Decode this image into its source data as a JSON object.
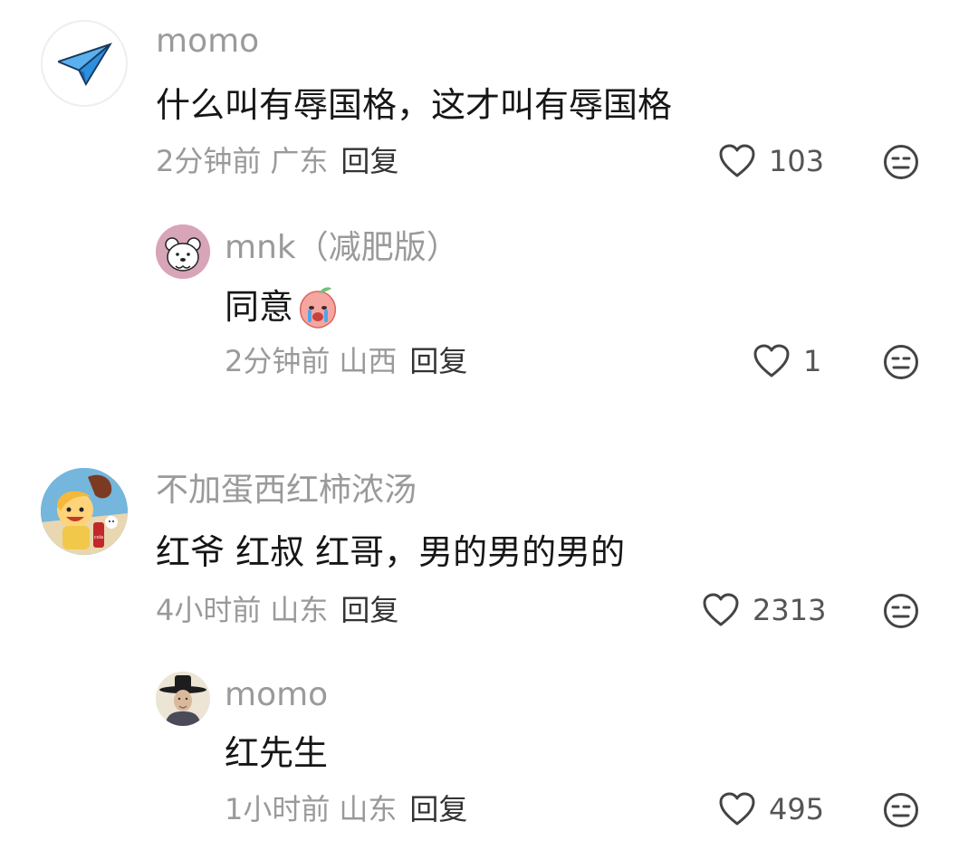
{
  "comments": [
    {
      "avatar": "paper-plane-icon",
      "username": "momo",
      "text": "什么叫有辱国格，这才叫有辱国格",
      "time": "2分钟前",
      "location": "广东",
      "reply_label": "回复",
      "likes": "103"
    },
    {
      "avatar": "bear-avatar",
      "username": "mnk（减肥版）",
      "text": "同意",
      "emoji": "crying-peach-emoji",
      "time": "2分钟前",
      "location": "山西",
      "reply_label": "回复",
      "likes": "1"
    },
    {
      "avatar": "cartoon-girl-avatar",
      "username": "不加蛋西红柿浓汤",
      "text": "红爷 红叔 红哥，男的男的男的",
      "time": "4小时前",
      "location": "山东",
      "reply_label": "回复",
      "likes": "2313"
    },
    {
      "avatar": "hat-man-avatar",
      "username": "momo",
      "text": "红先生",
      "time": "1小时前",
      "location": "山东",
      "reply_label": "回复",
      "likes": "495"
    }
  ],
  "icons": {
    "like": "heart-outline-icon",
    "dislike": "meh-face-icon"
  },
  "colors": {
    "username": "#9a9a9a",
    "text": "#161616",
    "meta": "#9a9a9a",
    "reply": "#333333"
  }
}
